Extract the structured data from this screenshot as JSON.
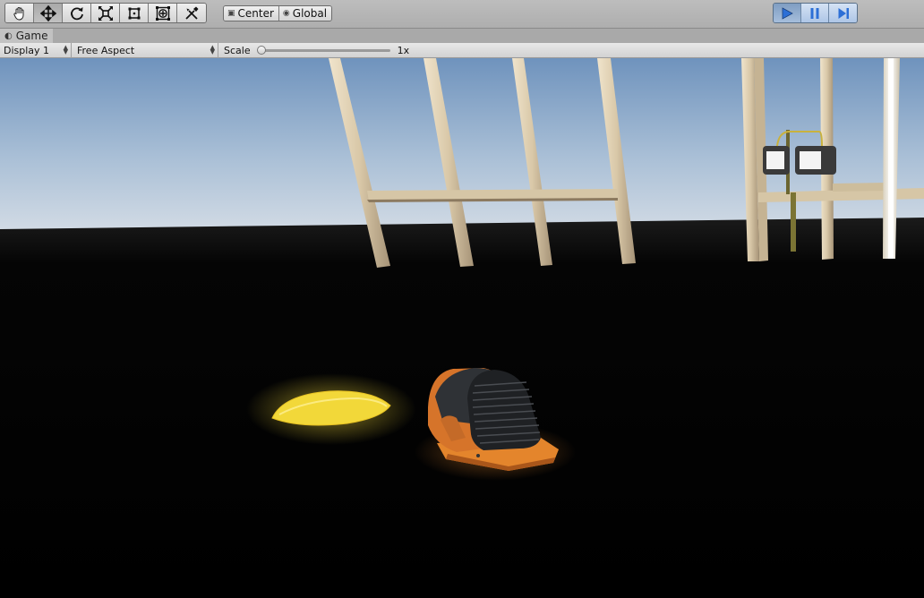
{
  "toolbar": {
    "tools": [
      {
        "name": "hand-tool",
        "icon": "hand-icon"
      },
      {
        "name": "move-tool",
        "icon": "move-arrows-icon",
        "active": true
      },
      {
        "name": "rotate-tool",
        "icon": "rotate-icon"
      },
      {
        "name": "scale-tool",
        "icon": "scale-icon"
      },
      {
        "name": "rect-tool",
        "icon": "rect-transform-icon"
      },
      {
        "name": "transform-tool",
        "icon": "transform-icon"
      },
      {
        "name": "custom-tool",
        "icon": "tools-icon"
      }
    ],
    "pivot_mode": "Center",
    "pivot_rotation": "Global",
    "play_controls": {
      "play": "play-icon",
      "pause": "pause-icon",
      "step": "step-icon",
      "playing": true
    }
  },
  "tab": {
    "label": "Game"
  },
  "game_bar": {
    "display": "Display 1",
    "aspect": "Free Aspect",
    "scale_label": "Scale",
    "scale_value": "1x",
    "scale_fraction": 0.0
  },
  "colors": {
    "sky_top": "#6f93bd",
    "sky_horizon": "#d5dde6",
    "ground": "#000000",
    "wood": "#d8c8aa",
    "yellow_object": "#f2d839",
    "orange_object": "#e4852c",
    "play_accent": "#2c6fd6"
  }
}
